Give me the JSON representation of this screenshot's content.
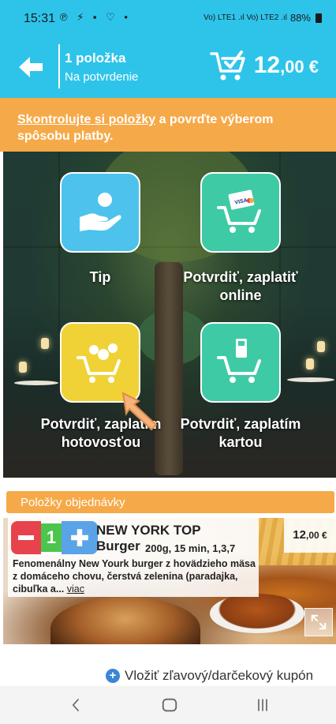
{
  "status_bar": {
    "time": "15:31",
    "left_icons": "℗ ⚡ ▪ ♡ •",
    "network": "Vo) LTE1 .ıl Vo) LTE2 .ıl",
    "battery": "88%"
  },
  "header": {
    "count_label": "1 položka",
    "subtitle": "Na potvrdenie",
    "price_main": "12",
    "price_cents": ",00 €"
  },
  "banner": {
    "link_text": "Skontrolujte si položky",
    "rest_text": " a povrďte výberom spôsobu platby."
  },
  "actions": [
    {
      "label": "Tip"
    },
    {
      "label": "Potvrdiť, zaplatiť online"
    },
    {
      "label": "Potvrdiť, zaplatím hotovosťou"
    },
    {
      "label": "Potvrdiť, zaplatím kartou"
    }
  ],
  "section": {
    "title": "Položky objednávky"
  },
  "item": {
    "quantity": "1",
    "name_line1": "NEW YORK TOP",
    "name_line2": "Burger",
    "meta": "200g, 15 min, 1,3,7",
    "description": "Fenomenálny New Yourk burger z hovädzieho mäsa z domáceho chovu, čerstvá zelenina (paradajka, cibuľka a...",
    "more_label": "viac",
    "price_main": "12",
    "price_cents": ",00 €"
  },
  "coupon": {
    "label": "Vložiť zľavový/darčekový kupón"
  },
  "colors": {
    "header": "#2ec4ea",
    "banner": "#f6a948",
    "tile_teal": "#3fcaa6",
    "tile_blue": "#4cc2ec",
    "tile_yellow": "#f1d236"
  }
}
